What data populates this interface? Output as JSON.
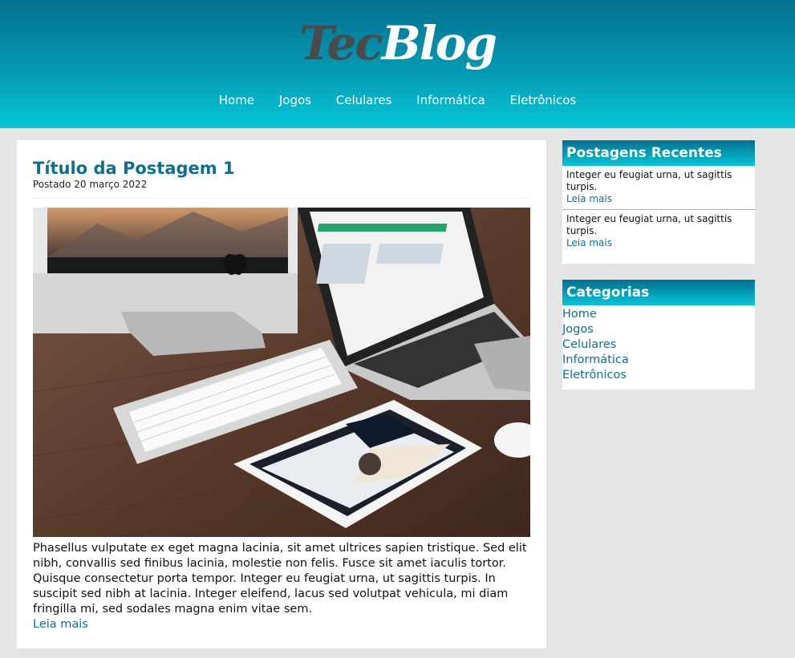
{
  "logo": {
    "part1": "Tec",
    "part2": "Blog"
  },
  "nav": {
    "items": [
      "Home",
      "Jogos",
      "Celulares",
      "Informática",
      "Eletrônicos"
    ]
  },
  "post": {
    "title": "Título da Postagem 1",
    "date": "Postado 20 março 2022",
    "image_alt": "desk with iMac, MacBook, keyboard, iPad and mouse",
    "body": "Phasellus vulputate ex eget magna lacinia, sit amet ultrices sapien tristique. Sed elit nibh, convallis sed finibus lacinia, molestie non felis. Fusce sit amet iaculis tortor. Quisque consectetur porta tempor. Integer eu feugiat urna, ut sagittis turpis. In suscipit sed nibh at lacinia. Integer eleifend, lacus sed volutpat vehicula, mi diam fringilla mi, sed sodales magna enim vitae sem.",
    "read_more": "Leia mais"
  },
  "recent": {
    "title": "Postagens Recentes",
    "items": [
      {
        "text": "Integer eu feugiat urna, ut sagittis turpis.",
        "link": "Leia mais"
      },
      {
        "text": "Integer eu feugiat urna, ut sagittis turpis.",
        "link": "Leia mais"
      }
    ]
  },
  "categories": {
    "title": "Categorias",
    "items": [
      "Home",
      "Jogos",
      "Celulares",
      "Informática",
      "Eletrônicos"
    ]
  },
  "colors": {
    "header_top": "#03708f",
    "header_bottom": "#06c6d8",
    "link": "#0f6f91",
    "background": "#e5e5e5"
  }
}
